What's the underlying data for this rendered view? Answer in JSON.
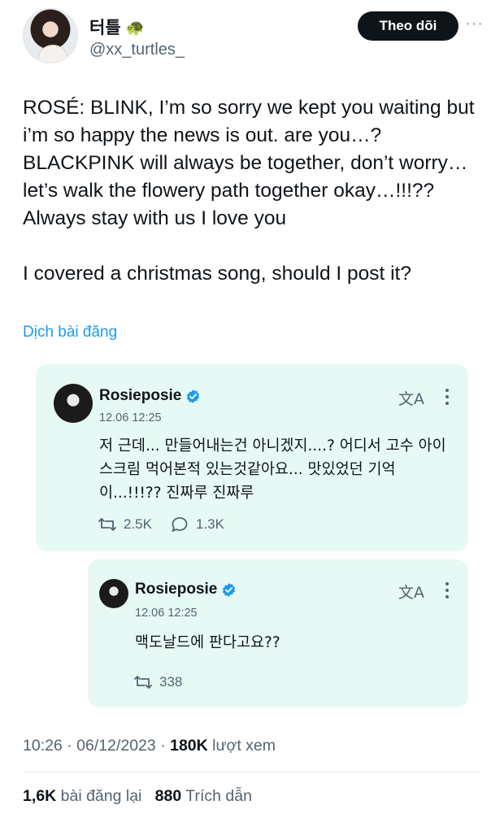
{
  "author": {
    "display_name": "터틀",
    "emoji": "🐢",
    "handle": "@xx_turtles_",
    "follow_label": "Theo dõi",
    "more_label": "···"
  },
  "tweet": {
    "paragraphs": [
      "ROSÉ: BLINK, I’m so sorry we kept you waiting but i’m so happy the news is out. are you…? BLACKPINK will always be together, don’t worry… let’s walk the flowery path together okay…!!!?? Always stay with us I love you",
      "I covered a christmas song, should I post it?"
    ],
    "translate_label": "Dịch bài đăng"
  },
  "quotes": [
    {
      "name": "Rosieposie",
      "time": "12.06 12:25",
      "text": "저 근데... 만들어내는건 아니겠지....? 어디서 고수 아이스크림 먹어본적 있는것같아요... 맛있었던 기억이...!!!?? 진짜루 진짜루",
      "reposts": "2.5K",
      "replies": "1.3K"
    },
    {
      "name": "Rosieposie",
      "time": "12.06 12:25",
      "text": "맥도날드에 판다고요??",
      "reposts": "338"
    }
  ],
  "meta": {
    "time": "10:26",
    "date": "06/12/2023",
    "views_count": "180K",
    "views_label": "lượt xem",
    "reposts_count": "1,6K",
    "reposts_label": "bài đăng lại",
    "quotes_count": "880",
    "quotes_label": "Trích dẫn"
  },
  "colors": {
    "link": "#1d9bf0",
    "quote_bg": "#e7f9f4",
    "verified": "#1d9bf0"
  }
}
